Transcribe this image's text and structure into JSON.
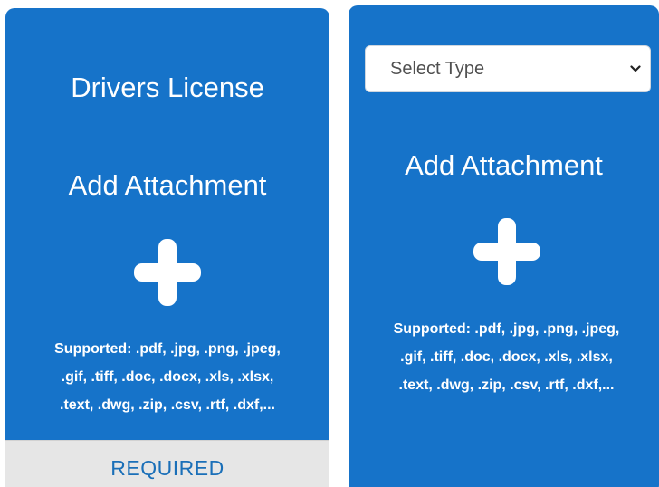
{
  "cards": [
    {
      "title": "Drivers License",
      "add_label": "Add Attachment",
      "supported_lines": [
        "Supported: .pdf, .jpg, .png, .jpeg,",
        ".gif, .tiff, .doc, .docx, .xls, .xlsx,",
        ".text, .dwg, .zip, .csv, .rtf, .dxf,..."
      ],
      "footer_label": "REQUIRED",
      "icon": "plus-icon"
    },
    {
      "type_select": {
        "value": "Select Type",
        "icon": "chevron-down-icon"
      },
      "add_label": "Add Attachment",
      "supported_lines": [
        "Supported: .pdf, .jpg, .png, .jpeg,",
        ".gif, .tiff, .doc, .docx, .xls, .xlsx,",
        ".text, .dwg, .zip, .csv, .rtf, .dxf,..."
      ],
      "icon": "plus-icon"
    }
  ],
  "colors": {
    "card_bg": "#1673c9",
    "footer_bg": "#e6e6e6",
    "footer_text": "#1a6fb8",
    "text": "#ffffff"
  }
}
